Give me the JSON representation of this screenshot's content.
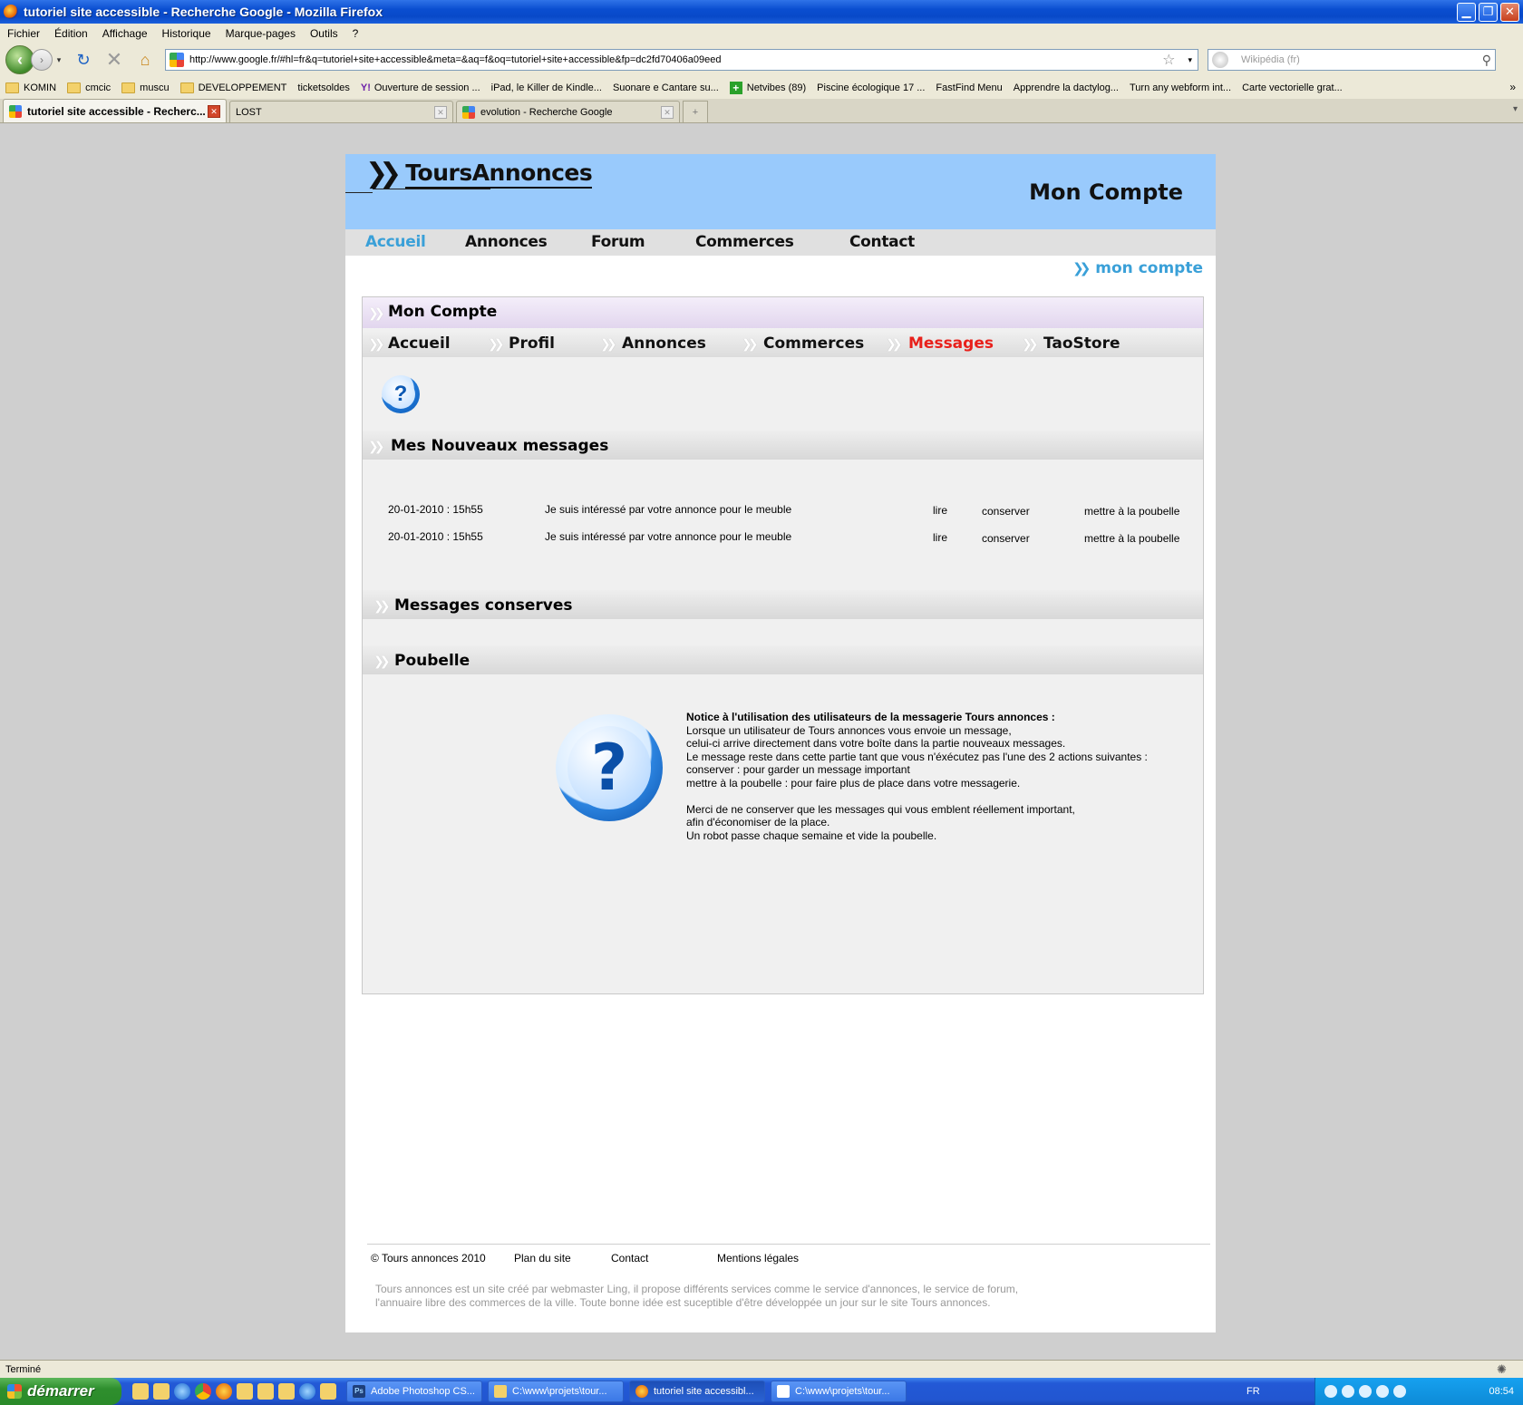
{
  "window": {
    "title": "tutoriel site accessible - Recherche Google - Mozilla Firefox",
    "minimize": "▁",
    "restore": "❐",
    "close": "✕"
  },
  "menu": [
    "Fichier",
    "Édition",
    "Affichage",
    "Historique",
    "Marque-pages",
    "Outils",
    "?"
  ],
  "toolbar": {
    "url": "http://www.google.fr/#hl=fr&q=tutoriel+site+accessible&meta=&aq=f&oq=tutoriel+site+accessible&fp=dc2fd70406a09eed",
    "search_placeholder": "Wikipédia (fr)"
  },
  "bookmarks": [
    {
      "label": "KOMIN",
      "icon": "folder"
    },
    {
      "label": "cmcic",
      "icon": "folder"
    },
    {
      "label": "muscu",
      "icon": "folder"
    },
    {
      "label": "DEVELOPPEMENT",
      "icon": "folder"
    },
    {
      "label": "ticketsoldes",
      "icon": "page"
    },
    {
      "label": "Ouverture de session ...",
      "icon": "yahoo"
    },
    {
      "label": "iPad, le Killer de Kindle...",
      "icon": "page"
    },
    {
      "label": "Suonare e Cantare su...",
      "icon": "page"
    },
    {
      "label": "Netvibes (89)",
      "icon": "plus"
    },
    {
      "label": "Piscine écologique 17 ...",
      "icon": "page"
    },
    {
      "label": "FastFind Menu",
      "icon": "page"
    },
    {
      "label": "Apprendre la dactylog...",
      "icon": "page"
    },
    {
      "label": "Turn any webform int...",
      "icon": "page"
    },
    {
      "label": "Carte vectorielle grat...",
      "icon": "page"
    }
  ],
  "tabs": [
    {
      "label": "tutoriel site accessible - Recherc...",
      "active": true,
      "icon": "google"
    },
    {
      "label": "LOST",
      "active": false,
      "icon": "page"
    },
    {
      "label": "evolution - Recherche Google",
      "active": false,
      "icon": "google"
    }
  ],
  "site": {
    "logo": "ToursAnnonces",
    "header_title": "Mon Compte",
    "nav": [
      "Accueil",
      "Annonces",
      "Forum",
      "Commerces",
      "Contact"
    ],
    "breadcrumb": "mon compte",
    "account_title": "Mon Compte",
    "subnav": [
      "Accueil",
      "Profil",
      "Annonces",
      "Commerces",
      "Messages",
      "TaoStore"
    ],
    "sections": {
      "new": "Mes Nouveaux messages",
      "kept": "Messages conserves",
      "trash": "Poubelle"
    },
    "messages": [
      {
        "date": "20-01-2010 : 15h55",
        "subject": "Je suis intéressé par votre annonce pour le meuble",
        "read": "lire",
        "keep": "conserver",
        "trash": "mettre à la poubelle"
      },
      {
        "date": "20-01-2010 : 15h55",
        "subject": "Je suis intéressé par votre annonce pour le meuble",
        "read": "lire",
        "keep": "conserver",
        "trash": "mettre à la poubelle"
      }
    ],
    "notice": {
      "title": "Notice à l'utilisation des utilisateurs de la messagerie Tours annonces :",
      "lines": [
        "Lorsque un utilisateur de Tours annonces vous envoie un message,",
        "celui-ci arrive directement dans votre boîte dans la partie nouveaux messages.",
        "Le message reste dans cette partie tant que vous n'éxécutez pas l'une des 2 actions suivantes :",
        "conserver : pour garder un message important",
        "mettre à la poubelle : pour faire plus de place dans votre messagerie.",
        "",
        "Merci de ne conserver que les messages qui vous emblent réellement important,",
        "afin d'économiser de la place.",
        "Un robot passe chaque semaine et vide la poubelle."
      ]
    },
    "footer": {
      "copyright": "© Tours annonces 2010",
      "links": [
        "Plan du site",
        "Contact",
        "Mentions légales"
      ],
      "text1": "Tours annonces est un site créé par webmaster Ling, il propose différents services comme le service d'annonces, le service de forum,",
      "text2": "l'annuaire libre des commerces de la ville. Toute bonne idée est suceptible d'être développée un jour sur le site Tours annonces."
    }
  },
  "status": "Terminé",
  "taskbar": {
    "start": "démarrer",
    "buttons": [
      {
        "label": "Adobe Photoshop CS...",
        "icon": "Ps",
        "active": false
      },
      {
        "label": "C:\\www\\projets\\tour...",
        "icon": "folder",
        "active": false
      },
      {
        "label": "tutoriel site accessibl...",
        "icon": "firefox",
        "active": true
      },
      {
        "label": "C:\\www\\projets\\tour...",
        "icon": "doc",
        "active": false
      }
    ],
    "lang": "FR",
    "clock": "08:54"
  }
}
